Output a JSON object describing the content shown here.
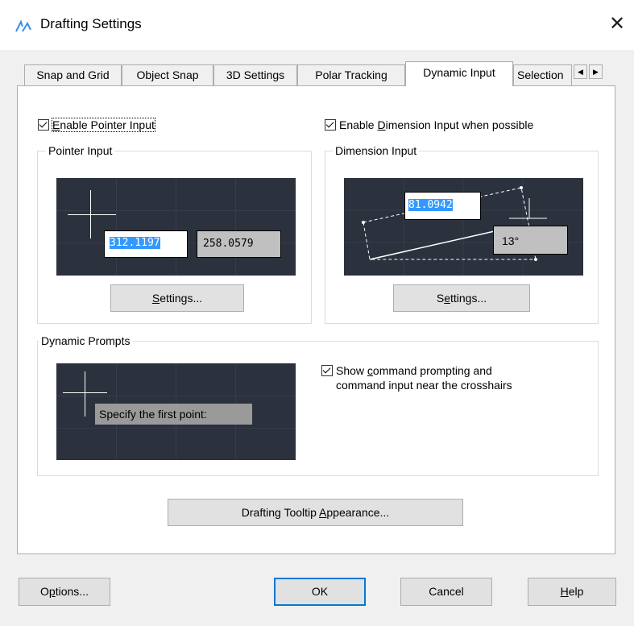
{
  "window": {
    "title": "Drafting Settings",
    "close_symbol": "✕"
  },
  "tabs": [
    {
      "label": "Snap and Grid",
      "active": false
    },
    {
      "label": "Object Snap",
      "active": false
    },
    {
      "label": "3D Settings",
      "active": false
    },
    {
      "label": "Polar Tracking",
      "active": false
    },
    {
      "label": "Dynamic Input",
      "active": true
    },
    {
      "label": "Selection",
      "active": false
    }
  ],
  "tab_scroll": {
    "left_icon": "◀",
    "right_icon": "▶"
  },
  "pointer_input": {
    "enable_label_pre": "",
    "enable_label_mnemonic": "E",
    "enable_label_post": "nable Pointer Input",
    "checked": true,
    "group_label": "Pointer Input",
    "value_x": "312.1197",
    "value_y": "258.0579",
    "settings_pre": "",
    "settings_mnemonic": "S",
    "settings_post": "ettings..."
  },
  "dimension_input": {
    "enable_label_pre": "Enable ",
    "enable_label_mnemonic": "D",
    "enable_label_post": "imension Input when possible",
    "checked": true,
    "group_label": "Dimension Input",
    "value_length": "81.0942",
    "value_angle": "13°",
    "settings_pre": "S",
    "settings_mnemonic": "e",
    "settings_post": "ttings..."
  },
  "dynamic_prompts": {
    "group_label": "Dynamic Prompts",
    "prompt_text": "Specify the first point:",
    "show_label_line1_pre": "Show ",
    "show_label_line1_mnemonic": "c",
    "show_label_line1_post": "ommand prompting and",
    "show_label_line2": "command input near the crosshairs",
    "checked": true
  },
  "tooltip_button": {
    "pre": "Drafting Tooltip ",
    "mnemonic": "A",
    "post": "ppearance..."
  },
  "footer": {
    "options_pre": "O",
    "options_mnemonic": "p",
    "options_post": "tions...",
    "ok": "OK",
    "cancel": "Cancel",
    "help_mnemonic": "H",
    "help_post": "elp"
  },
  "colors": {
    "preview_bg": "#2b313d",
    "selection": "#3399ff",
    "default_button_border": "#0078d7"
  }
}
